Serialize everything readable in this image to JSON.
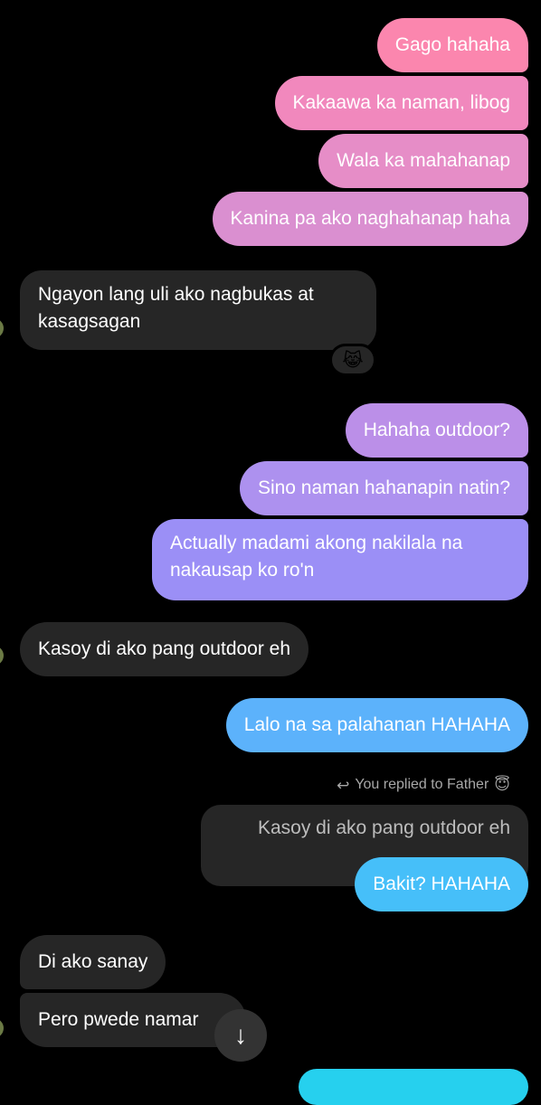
{
  "colors": {
    "background": "#000000",
    "incoming_bubble": "#262626",
    "outgoing_pink": "#f77fb3",
    "outgoing_purple": "#a88af0",
    "outgoing_blue": "#5cb2fb",
    "outgoing_cyan": "#26d0ee"
  },
  "messages": [
    {
      "text": "Gago hahaha"
    },
    {
      "text": "Kakaawa ka naman, libog"
    },
    {
      "text": "Wala ka mahahanap"
    },
    {
      "text": "Kanina pa ako naghahanap haha"
    },
    {
      "text": "Ngayon lang uli ako nagbukas at kasagsagan"
    },
    {
      "text": "Hahaha outdoor?"
    },
    {
      "text": "Sino naman hahanapin natin?"
    },
    {
      "text": "Actually madami akong nakilala na nakausap ko ro'n"
    },
    {
      "text": "Kasoy di ako pang outdoor eh"
    },
    {
      "text": "Lalo na sa palahanan HAHAHA"
    },
    {
      "text": "Bakit? HAHAHA"
    },
    {
      "text": "Di ako sanay"
    },
    {
      "text": "Pero pwede namar"
    }
  ],
  "reaction": {
    "emoji": "😹"
  },
  "reply": {
    "label": "You replied to Father",
    "label_emoji": "😇",
    "icon": "reply-arrow-icon",
    "quoted_text": "Kasoy di ako pang outdoor eh"
  },
  "scroll_button": {
    "icon": "arrow-down-icon",
    "glyph": "↓"
  }
}
